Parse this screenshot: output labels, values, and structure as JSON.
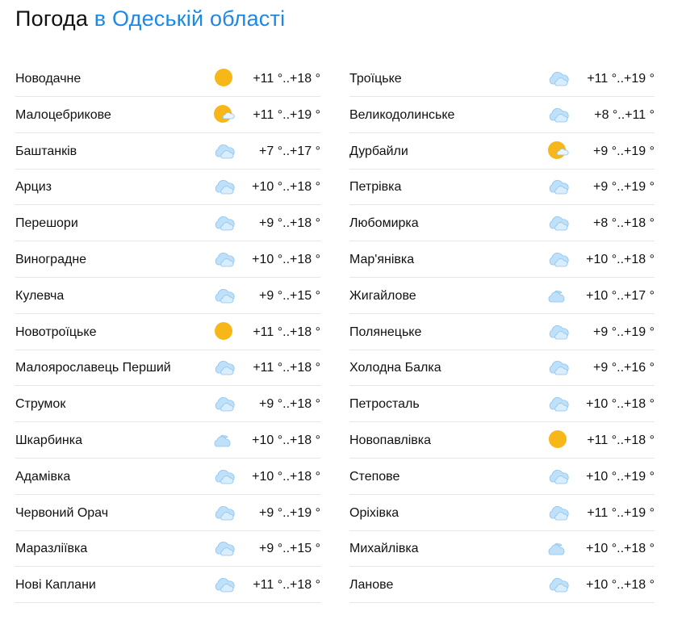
{
  "header": {
    "title": "Погода",
    "region_link": "в Одеській області"
  },
  "columns": [
    {
      "rows": [
        {
          "city": "Новодачне",
          "icon": "sun-icon",
          "temp": "+11 °..+18 °"
        },
        {
          "city": "Малоцебрикове",
          "icon": "sun-behind-small-cloud-icon",
          "temp": "+11 °..+19 °"
        },
        {
          "city": "Баштанків",
          "icon": "cloud-icon",
          "temp": "+7 °..+17 °"
        },
        {
          "city": "Арциз",
          "icon": "cloud-icon",
          "temp": "+10 °..+18 °"
        },
        {
          "city": "Перешори",
          "icon": "cloud-icon",
          "temp": "+9 °..+18 °"
        },
        {
          "city": "Виноградне",
          "icon": "cloud-icon",
          "temp": "+10 °..+18 °"
        },
        {
          "city": "Кулевча",
          "icon": "cloud-icon",
          "temp": "+9 °..+15 °"
        },
        {
          "city": "Новотроїцьке",
          "icon": "sun-icon",
          "temp": "+11 °..+18 °"
        },
        {
          "city": "Малоярославець Перший",
          "icon": "cloud-icon",
          "temp": "+11 °..+18 °"
        },
        {
          "city": "Струмок",
          "icon": "cloud-icon",
          "temp": "+9 °..+18 °"
        },
        {
          "city": "Шкарбинка",
          "icon": "small-cloud-icon",
          "temp": "+10 °..+18 °"
        },
        {
          "city": "Адамівка",
          "icon": "cloud-icon",
          "temp": "+10 °..+18 °"
        },
        {
          "city": "Червоний Орач",
          "icon": "cloud-icon",
          "temp": "+9 °..+19 °"
        },
        {
          "city": "Маразліївка",
          "icon": "cloud-icon",
          "temp": "+9 °..+15 °"
        },
        {
          "city": "Нові Каплани",
          "icon": "cloud-icon",
          "temp": "+11 °..+18 °"
        }
      ]
    },
    {
      "rows": [
        {
          "city": "Троїцьке",
          "icon": "cloud-icon",
          "temp": "+11 °..+19 °"
        },
        {
          "city": "Великодолинське",
          "icon": "cloud-icon",
          "temp": "+8 °..+11 °"
        },
        {
          "city": "Дурбайли",
          "icon": "sun-behind-small-cloud-icon",
          "temp": "+9 °..+19 °"
        },
        {
          "city": "Петрівка",
          "icon": "cloud-icon",
          "temp": "+9 °..+19 °"
        },
        {
          "city": "Любомирка",
          "icon": "cloud-icon",
          "temp": "+8 °..+18 °"
        },
        {
          "city": "Мар'янівка",
          "icon": "cloud-icon",
          "temp": "+10 °..+18 °"
        },
        {
          "city": "Жигайлове",
          "icon": "small-cloud-icon",
          "temp": "+10 °..+17 °"
        },
        {
          "city": "Полянецьке",
          "icon": "cloud-icon",
          "temp": "+9 °..+19 °"
        },
        {
          "city": "Холодна Балка",
          "icon": "cloud-icon",
          "temp": "+9 °..+16 °"
        },
        {
          "city": "Петросталь",
          "icon": "cloud-icon",
          "temp": "+10 °..+18 °"
        },
        {
          "city": "Новопавлівка",
          "icon": "sun-icon",
          "temp": "+11 °..+18 °"
        },
        {
          "city": "Степове",
          "icon": "cloud-icon",
          "temp": "+10 °..+19 °"
        },
        {
          "city": "Оріхівка",
          "icon": "cloud-icon",
          "temp": "+11 °..+19 °"
        },
        {
          "city": "Михайлівка",
          "icon": "small-cloud-icon",
          "temp": "+10 °..+18 °"
        },
        {
          "city": "Ланове",
          "icon": "cloud-icon",
          "temp": "+10 °..+18 °"
        }
      ]
    }
  ],
  "colors": {
    "accent": "#1e88e5",
    "sun": "#f7b718",
    "cloud": "#bfe0f9",
    "cloud_outline": "#8cc4ef",
    "divider": "#e6e6e6"
  }
}
